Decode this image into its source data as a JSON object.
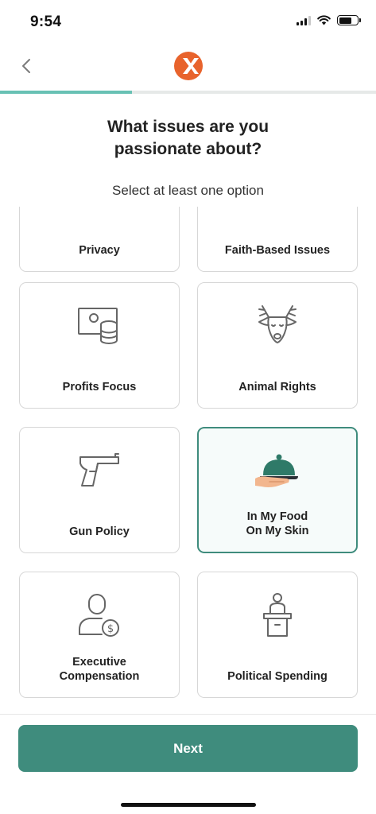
{
  "status_bar": {
    "time": "9:54"
  },
  "header": {
    "logo": "brand-logo"
  },
  "progress": {
    "value": 0.35
  },
  "title": "What issues are you\npassionate about?",
  "subtitle": "Select at least one option",
  "options": [
    {
      "label": "Privacy",
      "icon": "privacy-icon",
      "selected": false
    },
    {
      "label": "Faith-Based Issues",
      "icon": "faith-icon",
      "selected": false
    },
    {
      "label": "Profits Focus",
      "icon": "profits-icon",
      "selected": false
    },
    {
      "label": "Animal Rights",
      "icon": "deer-icon",
      "selected": false
    },
    {
      "label": "Gun Policy",
      "icon": "gun-icon",
      "selected": false
    },
    {
      "label": "In My Food\nOn My Skin",
      "icon": "food-cloche-icon",
      "selected": true
    },
    {
      "label": "Executive\nCompensation",
      "icon": "executive-icon",
      "selected": false
    },
    {
      "label": "Political Spending",
      "icon": "podium-icon",
      "selected": false
    }
  ],
  "next_button": {
    "label": "Next"
  },
  "colors": {
    "accent": "#3f8c7d",
    "progress": "#68c1b4",
    "logo": "#e8632c"
  }
}
